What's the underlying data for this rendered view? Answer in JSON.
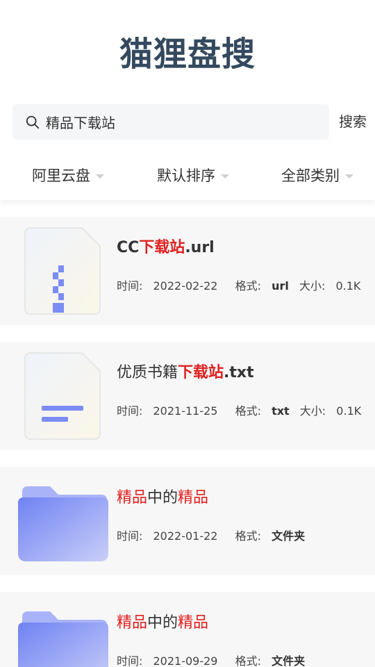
{
  "app": {
    "title": "猫狸盘搜"
  },
  "search": {
    "value": "精品下载站",
    "button_label": "搜索"
  },
  "filters": [
    {
      "label": "阿里云盘"
    },
    {
      "label": "默认排序"
    },
    {
      "label": "全部类别"
    }
  ],
  "results": [
    {
      "icon": "zip-file-icon",
      "name_parts": [
        "CC",
        "下载站",
        ".url"
      ],
      "time_label": "时间:",
      "time": "2022-02-22",
      "format_label": "格式:",
      "format": "url",
      "size_label": "大小:",
      "size": "0.1K"
    },
    {
      "icon": "text-file-icon",
      "name_parts": [
        "优质书籍",
        "下载站",
        ".txt"
      ],
      "time_label": "时间:",
      "time": "2021-11-25",
      "format_label": "格式:",
      "format": "txt",
      "size_label": "大小:",
      "size": "0.1K"
    },
    {
      "icon": "folder-icon",
      "name_parts": [
        "精品",
        "中的",
        "精品"
      ],
      "time_label": "时间:",
      "time": "2022-01-22",
      "format_label": "格式:",
      "format": "文件夹"
    },
    {
      "icon": "folder-icon",
      "name_parts": [
        "精品",
        "中的",
        "精品"
      ],
      "time_label": "时间:",
      "time": "2021-09-29",
      "format_label": "格式:",
      "format": "文件夹"
    }
  ],
  "colors": {
    "title": "#34495e",
    "highlight": "#e02020",
    "card_bg": "#f7f7f7",
    "folder": "#7b8cf5"
  }
}
